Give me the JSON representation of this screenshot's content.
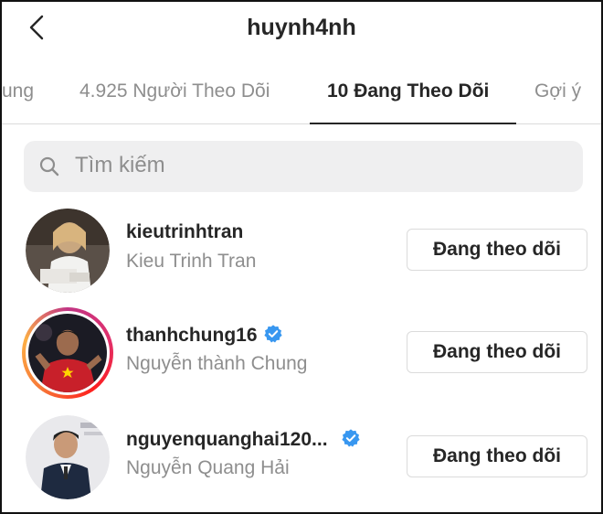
{
  "header": {
    "title": "huynh4nh"
  },
  "tabs": [
    {
      "label": "ung"
    },
    {
      "label": "4.925 Người Theo Dõi"
    },
    {
      "label": "10 Đang Theo Dõi"
    },
    {
      "label": "Gợi ý"
    }
  ],
  "search": {
    "placeholder": "Tìm kiếm"
  },
  "following": [
    {
      "username": "kieutrinhtran",
      "full_name": "Kieu Trinh Tran",
      "verified": false,
      "button_label": "Đang theo dõi",
      "story_ring": false
    },
    {
      "username": "thanhchung16",
      "full_name": "Nguyễn thành Chung",
      "verified": true,
      "button_label": "Đang theo dõi",
      "story_ring": true
    },
    {
      "username": "nguyenquanghai120...",
      "full_name": "Nguyễn Quang Hải",
      "verified": true,
      "button_label": "Đang theo dõi",
      "story_ring": false
    }
  ],
  "colors": {
    "verified_badge": "#3897f0",
    "secondary_text": "#8e8e8e",
    "search_bg": "#efeff0"
  }
}
